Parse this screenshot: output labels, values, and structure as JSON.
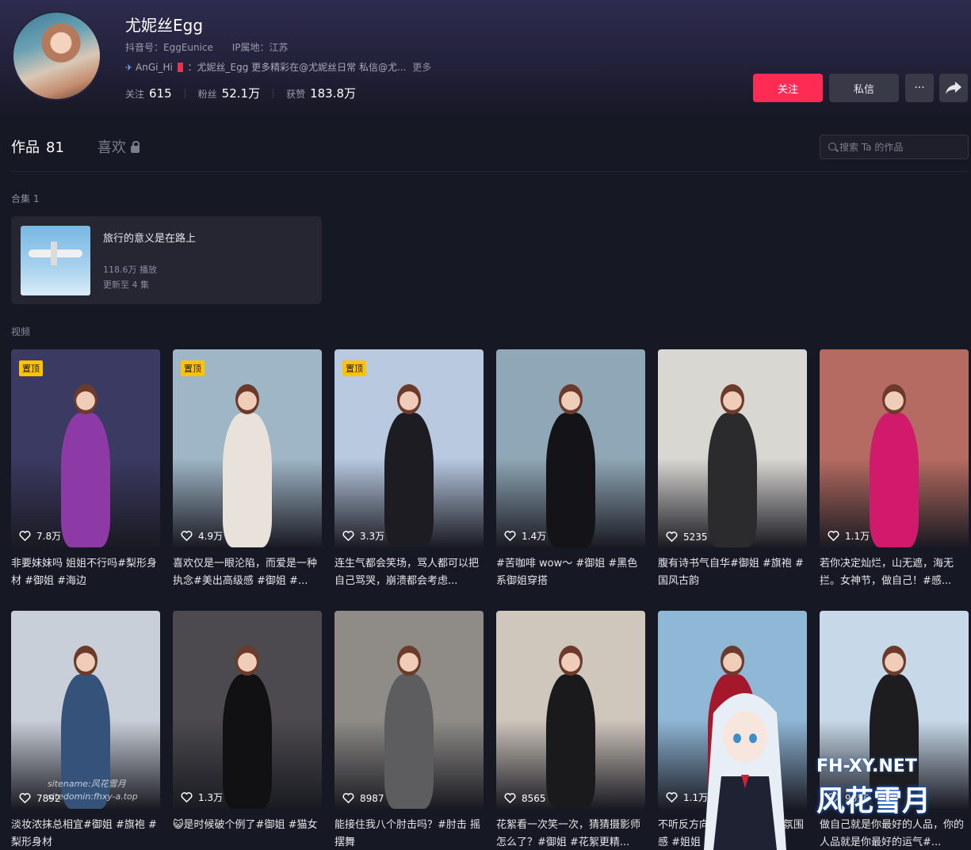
{
  "profile": {
    "name": "尤妮丝Egg",
    "douyin_id": "抖音号：EggEunice",
    "ip_location": "IP属地：江苏",
    "bio_user": "AnGi_Hi",
    "bio_text": "：尤妮丝_Egg 更多精彩在@尤妮丝日常 私信@尤...",
    "bio_more": "更多",
    "stats": {
      "following_label": "关注",
      "following": "615",
      "followers_label": "粉丝",
      "followers": "52.1万",
      "likes_label": "获赞",
      "likes": "183.8万"
    }
  },
  "actions": {
    "follow": "关注",
    "message": "私信",
    "more": "···"
  },
  "tabs": {
    "works_label": "作品",
    "works_count": "81",
    "likes_label": "喜欢"
  },
  "search": {
    "placeholder": "搜索 Ta 的作品"
  },
  "collections": {
    "label": "合集 1",
    "items": [
      {
        "title": "旅行的意义是在路上",
        "plays": "118.6万 播放",
        "update": "更新至 4 集"
      }
    ]
  },
  "videos": {
    "label": "视频",
    "pinned_label": "置顶",
    "items": [
      {
        "likes": "7.8万",
        "pinned": true,
        "caption": "非要妹妹吗 姐姐不行吗#梨形身材 #御姐 #海边",
        "colors": [
          "#3b3a62",
          "#8e3aa6"
        ]
      },
      {
        "likes": "4.9万",
        "pinned": true,
        "caption": "喜欢仅是一眼沦陷，而爱是一种执念#美出高级感 #御姐 #...",
        "colors": [
          "#9fb6c6",
          "#e9e2da"
        ]
      },
      {
        "likes": "3.3万",
        "pinned": true,
        "caption": "连生气都会笑场，骂人都可以把自己骂哭，崩溃都会考虑...",
        "colors": [
          "#b8c9e0",
          "#1c1c22"
        ]
      },
      {
        "likes": "1.4万",
        "pinned": false,
        "caption": "#苦咖啡 wow～ #御姐 #黑色系御姐穿搭",
        "colors": [
          "#8fa7b6",
          "#141418"
        ]
      },
      {
        "likes": "5235",
        "pinned": false,
        "caption": "腹有诗书气自华#御姐 #旗袍 #国风古韵",
        "colors": [
          "#d9d7d2",
          "#2b2b2e"
        ]
      },
      {
        "likes": "1.1万",
        "pinned": false,
        "caption": "若你决定灿烂，山无遮，海无拦。女神节，做自己！#感...",
        "colors": [
          "#b56b61",
          "#d11a6c"
        ]
      },
      {
        "likes": "7892",
        "pinned": false,
        "caption": "淡妆浓抹总相宜#御姐 #旗袍 #梨形身材",
        "colors": [
          "#c9cfd8",
          "#35537a"
        ]
      },
      {
        "likes": "1.3万",
        "pinned": false,
        "caption": "😺是时候破个例了#御姐 #猫女",
        "colors": [
          "#4c4a4e",
          "#111114"
        ]
      },
      {
        "likes": "8987",
        "pinned": false,
        "caption": "能接住我八个肘击吗？#肘击 摇摆舞",
        "colors": [
          "#8f8c88",
          "#5d5d60"
        ]
      },
      {
        "likes": "8565",
        "pinned": false,
        "caption": "花絮看一次笑一次，猜猜摄影师怎么了？#御姐 #花絮更精...",
        "colors": [
          "#cfc6bc",
          "#1a1a1c"
        ]
      },
      {
        "likes": "1.1万",
        "pinned": false,
        "caption": "不听反方向#御姐 #穿搭 #氛围感 #姐姐",
        "colors": [
          "#8fb7d6",
          "#a5182b"
        ]
      },
      {
        "likes": "9656",
        "pinned": false,
        "caption": "做自己就是你最好的人品，你的人品就是你最好的运气#...",
        "colors": [
          "#c7d9e8",
          "#1d1d20"
        ]
      }
    ]
  },
  "watermarks": {
    "site_name": "sitename:风花雪月",
    "site_domain": "sitedomin:fhxy-a.top",
    "logo_en": "FH-XY.NET",
    "logo_cn": "风花雪月"
  },
  "colors": {
    "accent": "#fe2c55",
    "pin_badge": "#ffc300",
    "background": "#161823"
  }
}
